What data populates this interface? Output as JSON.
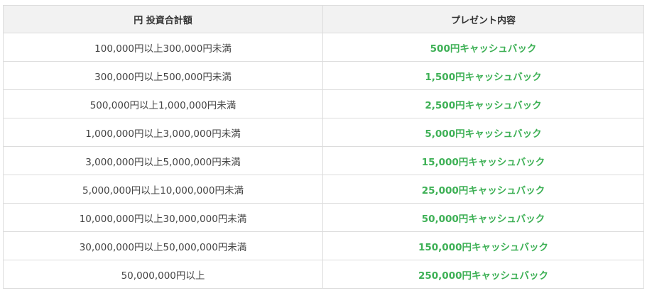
{
  "table": {
    "headers": [
      "円 投資合計額",
      "プレゼント内容"
    ],
    "rows": [
      {
        "amount": "100,000円以上300,000円未満",
        "reward": "500円キャッシュバック"
      },
      {
        "amount": "300,000円以上500,000円未満",
        "reward": "1,500円キャッシュバック"
      },
      {
        "amount": "500,000円以上1,000,000円未満",
        "reward": "2,500円キャッシュバック"
      },
      {
        "amount": "1,000,000円以上3,000,000円未満",
        "reward": "5,000円キャッシュバック"
      },
      {
        "amount": "3,000,000円以上5,000,000円未満",
        "reward": "15,000円キャッシュバック"
      },
      {
        "amount": "5,000,000円以上10,000,000円未満",
        "reward": "25,000円キャッシュバック"
      },
      {
        "amount": "10,000,000円以上30,000,000円未満",
        "reward": "50,000円キャッシュバック"
      },
      {
        "amount": "30,000,000円以上50,000,000円未満",
        "reward": "150,000円キャッシュバック"
      },
      {
        "amount": "50,000,000円以上",
        "reward": "250,000円キャッシュバック"
      }
    ]
  },
  "colors": {
    "header_bg": "#f2f2f2",
    "border": "#dcdcdc",
    "reward_text": "#3db055",
    "amount_text": "#444444"
  }
}
